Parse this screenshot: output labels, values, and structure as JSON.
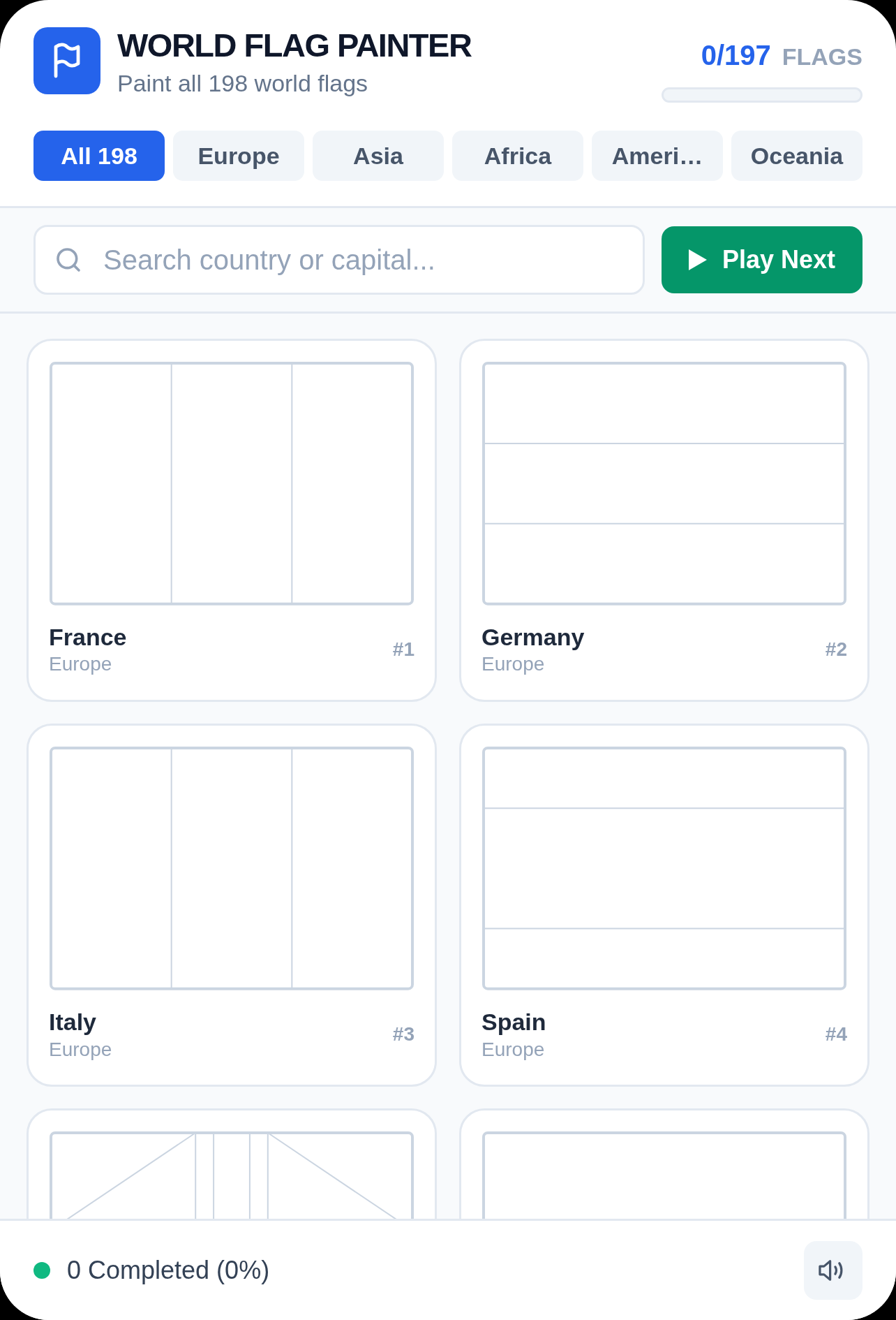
{
  "app": {
    "title": "WORLD FLAG PAINTER",
    "subtitle": "Paint all 198 world flags"
  },
  "progress": {
    "count": "0/197",
    "unit": "FLAGS",
    "level": 0
  },
  "tabs": [
    {
      "label": "All 198",
      "selected": true
    },
    {
      "label": "Europe",
      "selected": false
    },
    {
      "label": "Asia",
      "selected": false
    },
    {
      "label": "Africa",
      "selected": false
    },
    {
      "label": "Ameri…",
      "selected": false
    },
    {
      "label": "Oceania",
      "selected": false
    }
  ],
  "search": {
    "placeholder": "Search country or capital..."
  },
  "play_button": {
    "label": "Play Next"
  },
  "flags": [
    {
      "name": "France",
      "region": "Europe",
      "number": "#1",
      "kind": "vertical-tricolor"
    },
    {
      "name": "Germany",
      "region": "Europe",
      "number": "#2",
      "kind": "horizontal-tricolor"
    },
    {
      "name": "Italy",
      "region": "Europe",
      "number": "#3",
      "kind": "vertical-tricolor"
    },
    {
      "name": "Spain",
      "region": "Europe",
      "number": "#4",
      "kind": "horizontal-wide-band"
    },
    {
      "kind": "crossed-diagonals"
    },
    {
      "kind": "plain"
    }
  ],
  "status_bar": {
    "text": "0 Completed (0%)",
    "color": "#10b981"
  }
}
